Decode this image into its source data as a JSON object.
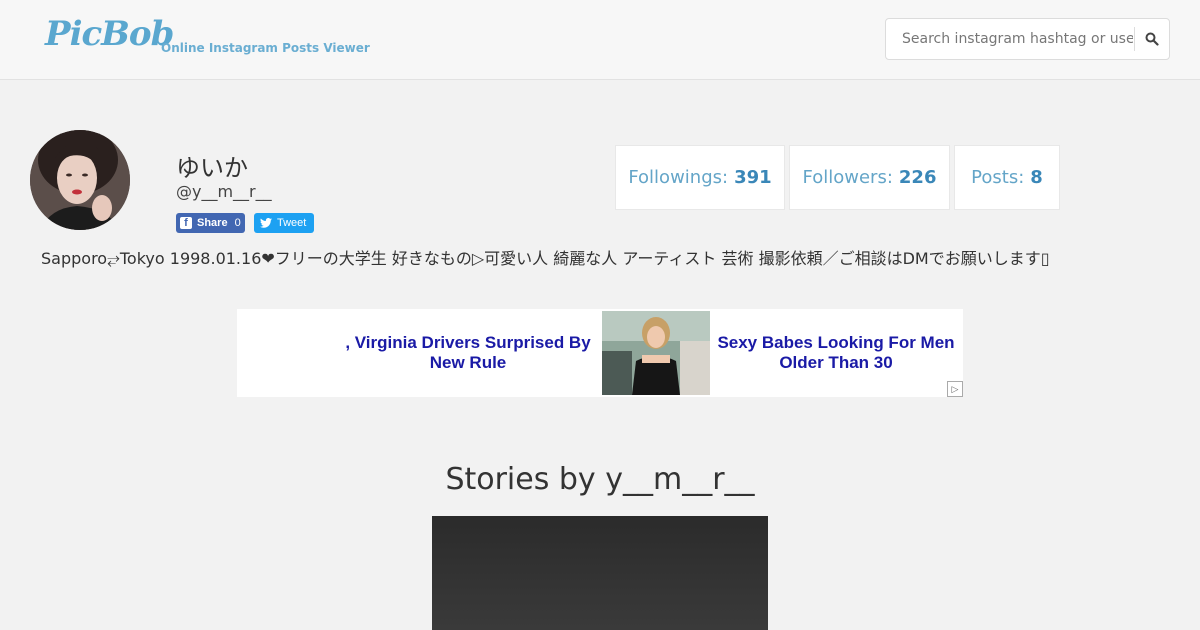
{
  "header": {
    "logo": "PicBob",
    "tagline": "Online Instagram Posts Viewer",
    "search_placeholder": "Search instagram hashtag or user"
  },
  "profile": {
    "display_name": "ゆいか",
    "username": "@y__m__r__",
    "share": {
      "fb_label": "Share",
      "fb_count": "0",
      "tweet_label": "Tweet"
    },
    "stats": [
      {
        "label": "Followings:",
        "value": "391"
      },
      {
        "label": "Followers:",
        "value": "226"
      },
      {
        "label": "Posts:",
        "value": "8"
      }
    ],
    "bio": "Sapporo⥂Tokyo 1998.01.16❤フリーの大学生 好きなもの▷可愛い人 綺麗な人 アーティスト 芸術 撮影依頼／ご相談はDMでお願いします▯"
  },
  "ad": {
    "left_headline": ", Virginia Drivers Surprised By New Rule",
    "right_headline": "Sexy Babes Looking For Men Older Than 30",
    "choice_icon": "adchoices-icon"
  },
  "stories": {
    "title": "Stories by y__m__r__"
  },
  "colors": {
    "accent": "#5aa7cf",
    "stat_value": "#3a87b8",
    "facebook": "#4267b2",
    "twitter": "#1da1f2",
    "ad_link": "#1a1aa6"
  }
}
